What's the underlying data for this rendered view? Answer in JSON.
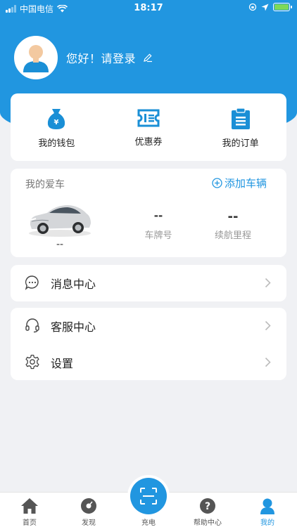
{
  "status_bar": {
    "carrier": "中国电信",
    "time": "18:17"
  },
  "profile": {
    "greeting": "您好！请登录"
  },
  "quick_actions": [
    {
      "label": "我的钱包",
      "icon": "wallet-icon"
    },
    {
      "label": "优惠券",
      "icon": "coupon-icon"
    },
    {
      "label": "我的订单",
      "icon": "order-icon"
    }
  ],
  "car": {
    "title": "我的爱车",
    "add_label": "添加车辆",
    "name": "--",
    "plate_value": "--",
    "plate_label": "车牌号",
    "range_value": "--",
    "range_label": "续航里程"
  },
  "menu": {
    "messages": "消息中心",
    "service": "客服中心",
    "settings": "设置"
  },
  "tabs": [
    {
      "label": "首页",
      "icon": "home-icon"
    },
    {
      "label": "发现",
      "icon": "discover-icon"
    },
    {
      "label": "充电",
      "icon": "scan-icon"
    },
    {
      "label": "帮助中心",
      "icon": "help-icon"
    },
    {
      "label": "我的",
      "icon": "profile-icon"
    }
  ],
  "colors": {
    "primary": "#2196e0",
    "background": "#f0f1f4",
    "battery": "#7ed957"
  }
}
